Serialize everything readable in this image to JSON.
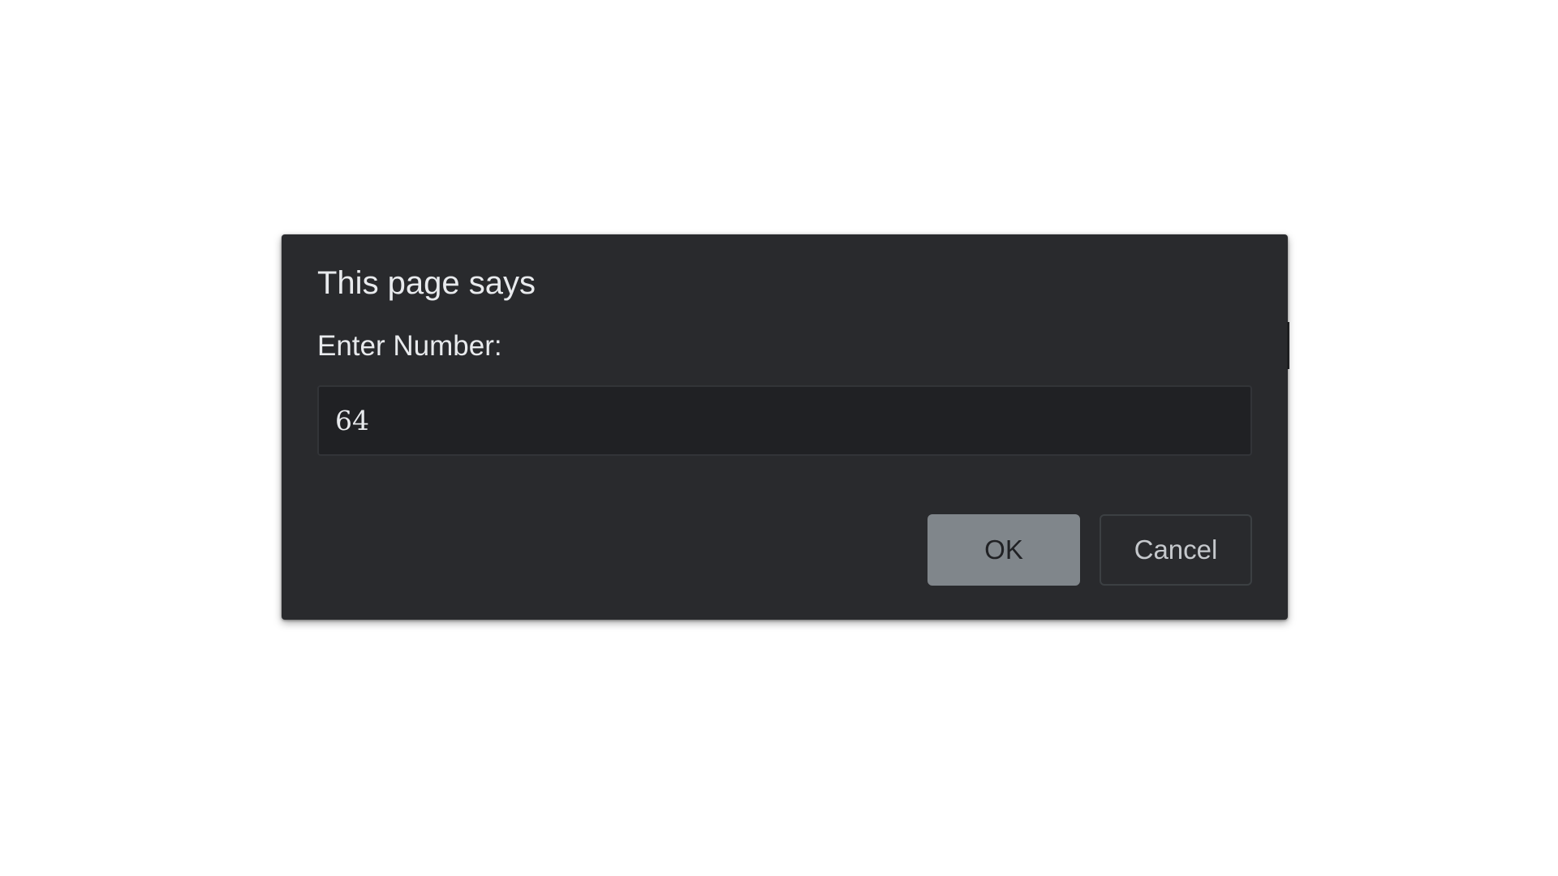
{
  "dialog": {
    "title": "This page says",
    "message": "Enter Number:",
    "input": {
      "value": "64",
      "placeholder": ""
    },
    "buttons": {
      "ok_label": "OK",
      "cancel_label": "Cancel"
    }
  },
  "colors": {
    "page_background": "#ffffff",
    "dialog_background": "#292a2d",
    "input_background": "#202124",
    "text": "#e8eaed",
    "ok_button": "#80868b"
  }
}
